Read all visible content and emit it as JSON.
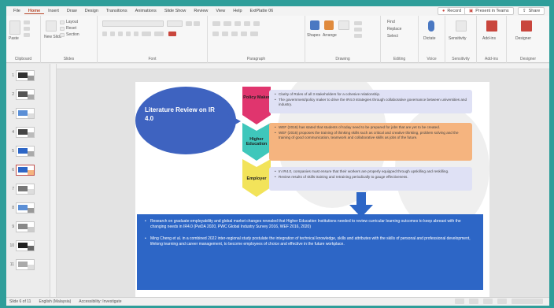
{
  "ribbon_tabs": [
    "File",
    "Home",
    "Insert",
    "Draw",
    "Design",
    "Transitions",
    "Animations",
    "Slide Show",
    "Review",
    "View",
    "Help",
    "ExtPlatte 06"
  ],
  "ribbon_tab_active_index": 1,
  "ribbon_right": {
    "record": "Record",
    "present": "Present in Teams",
    "share": "Share"
  },
  "ribbon_groups": {
    "clipboard": "Clipboard",
    "slides": "Slides",
    "font": "Font",
    "paragraph": "Paragraph",
    "drawing": "Drawing",
    "editing": "Editing",
    "voice": "Voice",
    "sensitivity": "Sensitivity",
    "addins": "Add-ins",
    "designer": "Designer"
  },
  "ribbon_buttons": {
    "paste": "Paste",
    "new_slide": "New Slide",
    "layout": "Layout",
    "reset": "Reset",
    "section": "Section",
    "shapes": "Shapes",
    "arrange": "Arrange",
    "find": "Find",
    "replace": "Replace",
    "select": "Select",
    "dictate": "Dictate",
    "sensitivity": "Sensitivity",
    "addins": "Add-ins",
    "designer": "Designer"
  },
  "thumbnails": [
    {
      "num": "1"
    },
    {
      "num": "2"
    },
    {
      "num": "3"
    },
    {
      "num": "4"
    },
    {
      "num": "5"
    },
    {
      "num": "6",
      "selected": true
    },
    {
      "num": "7"
    },
    {
      "num": "8"
    },
    {
      "num": "9"
    },
    {
      "num": "10"
    },
    {
      "num": "11"
    }
  ],
  "slide": {
    "title": "Literature Review on IR 4.0",
    "chevrons": [
      {
        "label": "Policy Maker",
        "color": "#e0356e"
      },
      {
        "label": "Higher Education",
        "color": "#3fc7bb"
      },
      {
        "label": "Employer",
        "color": "#f2e35a"
      }
    ],
    "panels": [
      {
        "bg": "#dfe1f5",
        "bullets": [
          "Clarity of Roles of all 3 stakeholders for a cohesive relationship.",
          "The government/policy maker to drive the IR4.0 strategies through collaborative governance between universities and industry."
        ]
      },
      {
        "bg": "#f5b47f",
        "bullets": [
          "WEF (2016) has stated that students of today need to be prepared for jobs that are yet to be created.",
          "WEF (2016) proposes the training of thinking skills such as critical and creative thinking, problem solving and the training of good communication, teamwork and collaborative skills as jobs of the future."
        ]
      },
      {
        "bg": "#dfe1f5",
        "bullets": [
          "In IR4.0, companies must ensure that their workers are properly equipped through upskilling and reskilling.",
          "Review results of skills training and retraining periodically to gauge effectiveness."
        ]
      }
    ],
    "summary": [
      "Research on graduate employability and global market changes revealed that Higher Education Institutions needed to review curricular learning outcomes to keep abreast with the changing needs in IR4.0 (PwDA 2020, PWC Global Industry Survey 2016, WEF 2016, 2020)",
      "Ming Cheng et al. in a combined 2022 inter-regional study postulate the integration of technical knowledge, skills and attributes with the skills of personal and professional development, lifelong learning and career management, to become employees of choice and effective in the future workplace."
    ]
  },
  "status": {
    "slide_counter": "Slide 6 of 11",
    "language": "English (Malaysia)",
    "accessibility": "Accessibility: Investigate"
  }
}
